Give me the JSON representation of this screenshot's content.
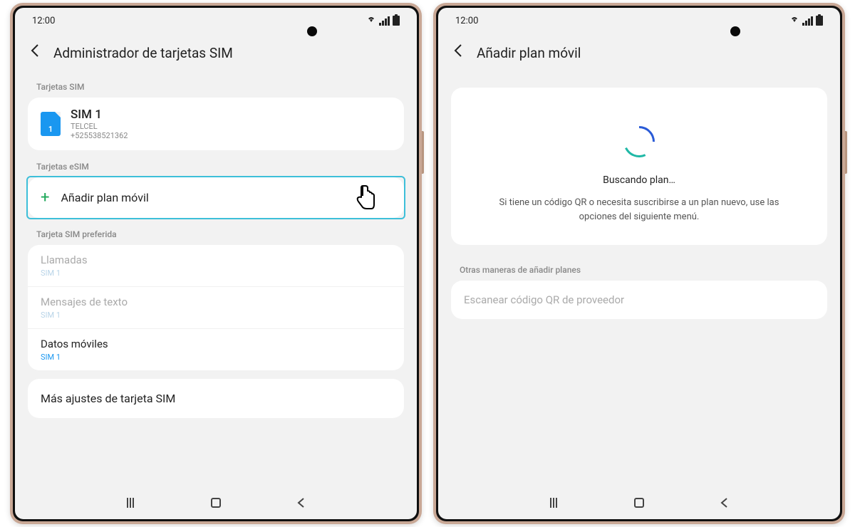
{
  "device_left": {
    "status": {
      "time": "12:00"
    },
    "header": {
      "title": "Administrador de tarjetas SIM"
    },
    "sections": {
      "sim_cards_label": "Tarjetas SIM",
      "sim1": {
        "name": "SIM 1",
        "carrier": "TELCEL",
        "phone": "+525538521362",
        "badge": "1"
      },
      "esim_label": "Tarjetas eSIM",
      "add_plan": "Añadir plan móvil",
      "preferred_label": "Tarjeta SIM preferida",
      "calls": {
        "label": "Llamadas",
        "value": "SIM 1"
      },
      "texts": {
        "label": "Mensajes de texto",
        "value": "SIM 1"
      },
      "data": {
        "label": "Datos móviles",
        "value": "SIM 1"
      },
      "more": "Más ajustes de tarjeta SIM"
    }
  },
  "device_right": {
    "status": {
      "time": "12:00"
    },
    "header": {
      "title": "Añadir plan móvil"
    },
    "loading": {
      "title": "Buscando plan…",
      "desc": "Si tiene un código QR o necesita suscribirse a un plan nuevo, use las opciones del siguiente menú."
    },
    "other_label": "Otras maneras de añadir planes",
    "scan_qr": "Escanear código QR de proveedor"
  }
}
